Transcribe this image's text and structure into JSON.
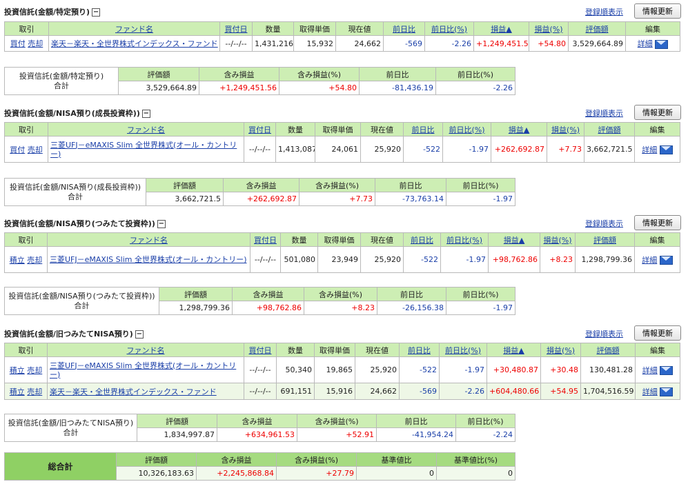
{
  "labels": {
    "order_link": "登録順表示",
    "refresh": "情報更新",
    "total": "合計",
    "detail": "詳細",
    "sell": "売却"
  },
  "main_headers": [
    "取引",
    "ファンド名",
    "買付日",
    "数量",
    "取得単価",
    "現在値",
    "前日比",
    "前日比(%)",
    "損益▲",
    "損益(%)",
    "評価額",
    "編集"
  ],
  "sum_headers": [
    "評価額",
    "含み損益",
    "含み損益(%)",
    "前日比",
    "前日比(%)"
  ],
  "sections": [
    {
      "title": "投資信託(金額/特定預り)",
      "sum_label": "投資信託(金額/特定預り)",
      "rows": [
        {
          "buy": "買付",
          "fund": "楽天－楽天・全世界株式インデックス・ファンド",
          "date": "--/--/--",
          "qty": "1,431,216",
          "cost": "15,932",
          "price": "24,662",
          "chg": "-569",
          "chgp": "-2.26",
          "pl": "+1,249,451.56",
          "plp": "+54.80",
          "val": "3,529,664.89"
        }
      ],
      "sum": {
        "val": "3,529,664.89",
        "pl": "+1,249,451.56",
        "plp": "+54.80",
        "chg": "-81,436.19",
        "chgp": "-2.26"
      }
    },
    {
      "title": "投資信託(金額/NISA預り(成長投資枠))",
      "sum_label": "投資信託(金額/NISA預り(成長投資枠))",
      "rows": [
        {
          "buy": "買付",
          "fund": "三菱UFJ－eMAXIS Slim 全世界株式(オール・カントリー)",
          "date": "--/--/--",
          "qty": "1,413,087",
          "cost": "24,061",
          "price": "25,920",
          "chg": "-522",
          "chgp": "-1.97",
          "pl": "+262,692.87",
          "plp": "+7.73",
          "val": "3,662,721.5"
        }
      ],
      "sum": {
        "val": "3,662,721.5",
        "pl": "+262,692.87",
        "plp": "+7.73",
        "chg": "-73,763.14",
        "chgp": "-1.97"
      }
    },
    {
      "title": "投資信託(金額/NISA預り(つみたて投資枠))",
      "sum_label": "投資信託(金額/NISA預り(つみたて投資枠))",
      "rows": [
        {
          "buy": "積立",
          "fund": "三菱UFJ－eMAXIS Slim 全世界株式(オール・カントリー)",
          "date": "--/--/--",
          "qty": "501,080",
          "cost": "23,949",
          "price": "25,920",
          "chg": "-522",
          "chgp": "-1.97",
          "pl": "+98,762.86",
          "plp": "+8.23",
          "val": "1,298,799.36"
        }
      ],
      "sum": {
        "val": "1,298,799.36",
        "pl": "+98,762.86",
        "plp": "+8.23",
        "chg": "-26,156.38",
        "chgp": "-1.97"
      }
    },
    {
      "title": "投資信託(金額/旧つみたてNISA預り)",
      "sum_label": "投資信託(金額/旧つみたてNISA預り)",
      "rows": [
        {
          "buy": "積立",
          "fund": "三菱UFJ－eMAXIS Slim 全世界株式(オール・カントリー)",
          "date": "--/--/--",
          "qty": "50,340",
          "cost": "19,865",
          "price": "25,920",
          "chg": "-522",
          "chgp": "-1.97",
          "pl": "+30,480.87",
          "plp": "+30.48",
          "val": "130,481.28"
        },
        {
          "buy": "積立",
          "fund": "楽天－楽天・全世界株式インデックス・ファンド",
          "date": "--/--/--",
          "qty": "691,151",
          "cost": "15,916",
          "price": "24,662",
          "chg": "-569",
          "chgp": "-2.26",
          "pl": "+604,480.66",
          "plp": "+54.95",
          "val": "1,704,516.59"
        }
      ],
      "sum": {
        "val": "1,834,997.87",
        "pl": "+634,961.53",
        "plp": "+52.91",
        "chg": "-41,954.24",
        "chgp": "-2.24"
      }
    }
  ],
  "grand_total": {
    "label": "総合計",
    "headers": [
      "評価額",
      "含み損益",
      "含み損益(%)",
      "基準値比",
      "基準値比(%)"
    ],
    "values": [
      "10,326,183.63",
      "+2,245,868.84",
      "+27.79",
      "0",
      "0"
    ]
  },
  "colors": {
    "header_green": "#cdeeb4",
    "positive": "#ee0000",
    "negative": "#1a3fa8"
  }
}
